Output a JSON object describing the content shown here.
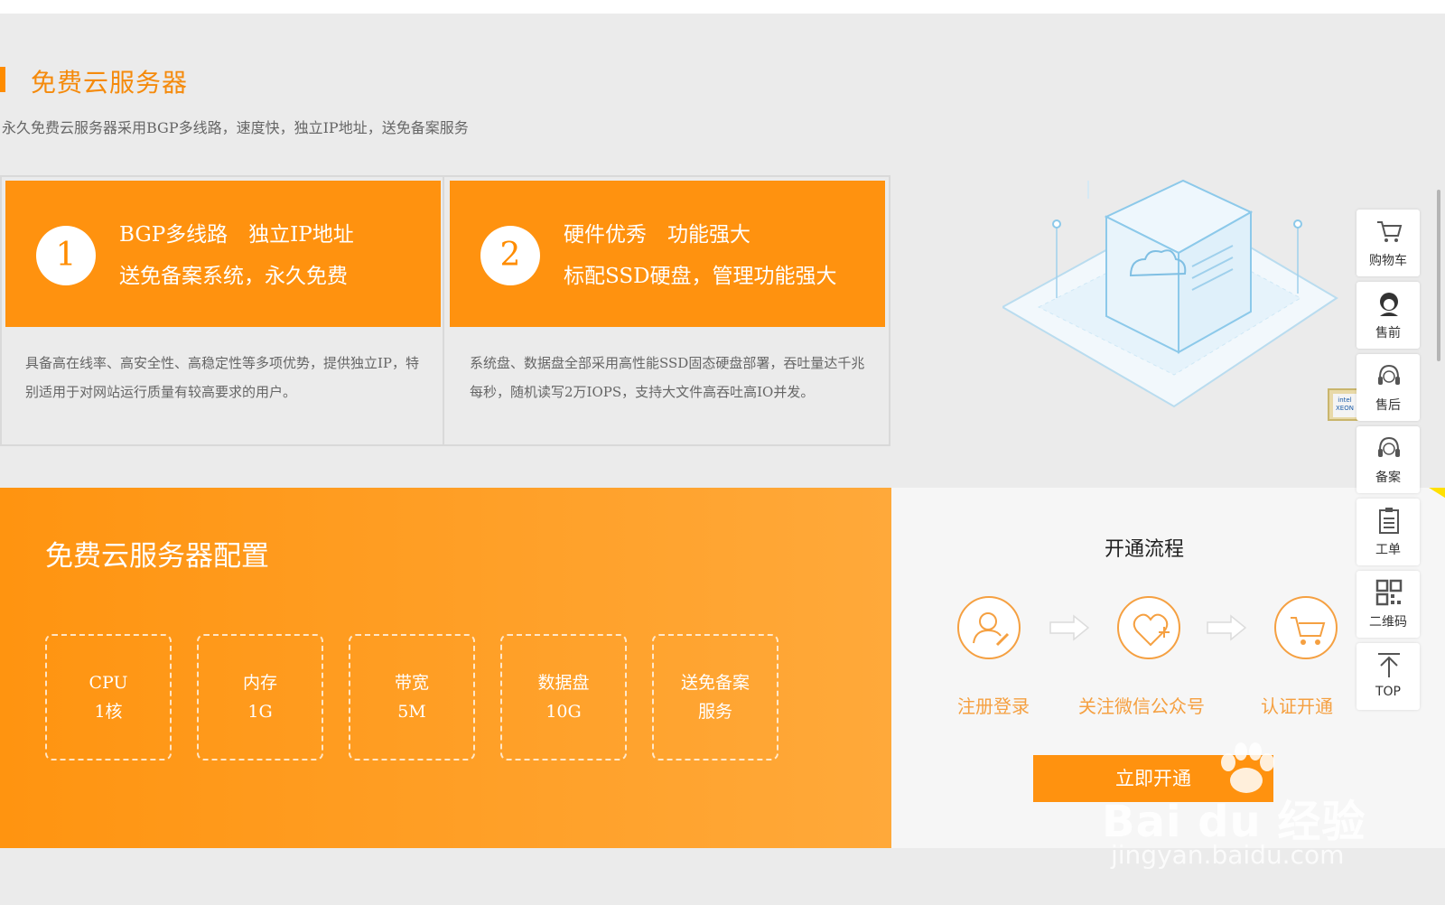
{
  "section": {
    "title": "免费云服务器",
    "subtitle": "永久免费云服务器采用BGP多线路，速度快，独立IP地址，送免备案服务"
  },
  "cards": [
    {
      "number": "1",
      "line1": "BGP多线路　独立IP地址",
      "line2": "送免备案系统，永久免费",
      "description": "具备高在线率、高安全性、高稳定性等多项优势，提供独立IP，特别适用于对网站运行质量有较高要求的用户。"
    },
    {
      "number": "2",
      "line1": "硬件优秀　功能强大",
      "line2": "标配SSD硬盘，管理功能强大",
      "description": "系统盘、数据盘全部采用高性能SSD固态硬盘部署，吞吐量达千兆每秒，随机读写2万IOPS，支持大文件高吞吐高IO并发。"
    }
  ],
  "config": {
    "title": "免费云服务器配置",
    "specs": [
      {
        "name": "CPU",
        "value": "1核"
      },
      {
        "name": "内存",
        "value": "1G"
      },
      {
        "name": "带宽",
        "value": "5M"
      },
      {
        "name": "数据盘",
        "value": "10G"
      },
      {
        "name": "送免备案",
        "value": "服务"
      }
    ]
  },
  "process": {
    "title": "开通流程",
    "steps": [
      {
        "label": "注册登录",
        "icon": "user-register-icon"
      },
      {
        "label": "关注微信公众号",
        "icon": "heart-plus-icon"
      },
      {
        "label": "认证开通",
        "icon": "cart-icon"
      }
    ],
    "button": "立即开通"
  },
  "sidebar": {
    "items": [
      {
        "label": "购物车",
        "icon": "cart-icon"
      },
      {
        "label": "售前",
        "icon": "agent-icon"
      },
      {
        "label": "售后",
        "icon": "headset-icon"
      },
      {
        "label": "备案",
        "icon": "headset-icon"
      },
      {
        "label": "工单",
        "icon": "clipboard-icon"
      },
      {
        "label": "二维码",
        "icon": "qrcode-icon"
      },
      {
        "label": "TOP",
        "icon": "arrow-up-icon"
      }
    ]
  },
  "chip": {
    "text": "intel XEON"
  },
  "watermark": {
    "brand": "Bai du 经验",
    "url": "jingyan.baidu.com"
  },
  "colors": {
    "accent": "#ff920f",
    "highlight": "#ffe000",
    "step": "#f5a041"
  }
}
